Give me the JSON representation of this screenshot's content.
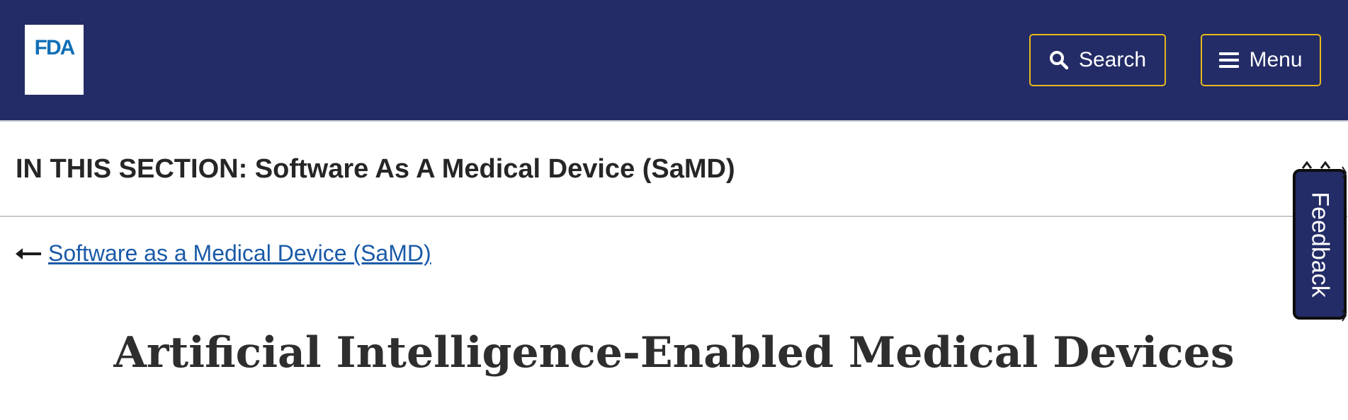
{
  "header": {
    "logo_text": "FDA",
    "search_label": "Search",
    "menu_label": "Menu",
    "search_icon": "search-icon",
    "menu_icon": "hamburger-icon",
    "colors": {
      "bar_background": "#232c67",
      "button_border": "#e8b81a",
      "logo_blue": "#0f6fb6"
    }
  },
  "section": {
    "title": "IN THIS SECTION: Software As A Medical Device (SaMD)"
  },
  "breadcrumb": {
    "back_icon": "arrow-left-icon",
    "link_text": "Software as a Medical Device (SaMD)",
    "link_color": "#1a5aa8"
  },
  "main": {
    "title": "Artificial Intelligence-Enabled Medical Devices"
  },
  "feedback": {
    "label": "Feedback",
    "background": "#232c67"
  }
}
